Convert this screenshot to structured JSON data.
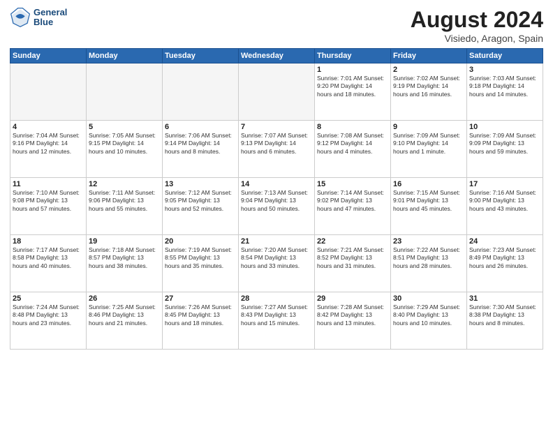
{
  "header": {
    "logo_line1": "General",
    "logo_line2": "Blue",
    "month_title": "August 2024",
    "location": "Visiedo, Aragon, Spain"
  },
  "weekdays": [
    "Sunday",
    "Monday",
    "Tuesday",
    "Wednesday",
    "Thursday",
    "Friday",
    "Saturday"
  ],
  "weeks": [
    [
      {
        "day": "",
        "info": ""
      },
      {
        "day": "",
        "info": ""
      },
      {
        "day": "",
        "info": ""
      },
      {
        "day": "",
        "info": ""
      },
      {
        "day": "1",
        "info": "Sunrise: 7:01 AM\nSunset: 9:20 PM\nDaylight: 14 hours\nand 18 minutes."
      },
      {
        "day": "2",
        "info": "Sunrise: 7:02 AM\nSunset: 9:19 PM\nDaylight: 14 hours\nand 16 minutes."
      },
      {
        "day": "3",
        "info": "Sunrise: 7:03 AM\nSunset: 9:18 PM\nDaylight: 14 hours\nand 14 minutes."
      }
    ],
    [
      {
        "day": "4",
        "info": "Sunrise: 7:04 AM\nSunset: 9:16 PM\nDaylight: 14 hours\nand 12 minutes."
      },
      {
        "day": "5",
        "info": "Sunrise: 7:05 AM\nSunset: 9:15 PM\nDaylight: 14 hours\nand 10 minutes."
      },
      {
        "day": "6",
        "info": "Sunrise: 7:06 AM\nSunset: 9:14 PM\nDaylight: 14 hours\nand 8 minutes."
      },
      {
        "day": "7",
        "info": "Sunrise: 7:07 AM\nSunset: 9:13 PM\nDaylight: 14 hours\nand 6 minutes."
      },
      {
        "day": "8",
        "info": "Sunrise: 7:08 AM\nSunset: 9:12 PM\nDaylight: 14 hours\nand 4 minutes."
      },
      {
        "day": "9",
        "info": "Sunrise: 7:09 AM\nSunset: 9:10 PM\nDaylight: 14 hours\nand 1 minute."
      },
      {
        "day": "10",
        "info": "Sunrise: 7:09 AM\nSunset: 9:09 PM\nDaylight: 13 hours\nand 59 minutes."
      }
    ],
    [
      {
        "day": "11",
        "info": "Sunrise: 7:10 AM\nSunset: 9:08 PM\nDaylight: 13 hours\nand 57 minutes."
      },
      {
        "day": "12",
        "info": "Sunrise: 7:11 AM\nSunset: 9:06 PM\nDaylight: 13 hours\nand 55 minutes."
      },
      {
        "day": "13",
        "info": "Sunrise: 7:12 AM\nSunset: 9:05 PM\nDaylight: 13 hours\nand 52 minutes."
      },
      {
        "day": "14",
        "info": "Sunrise: 7:13 AM\nSunset: 9:04 PM\nDaylight: 13 hours\nand 50 minutes."
      },
      {
        "day": "15",
        "info": "Sunrise: 7:14 AM\nSunset: 9:02 PM\nDaylight: 13 hours\nand 47 minutes."
      },
      {
        "day": "16",
        "info": "Sunrise: 7:15 AM\nSunset: 9:01 PM\nDaylight: 13 hours\nand 45 minutes."
      },
      {
        "day": "17",
        "info": "Sunrise: 7:16 AM\nSunset: 9:00 PM\nDaylight: 13 hours\nand 43 minutes."
      }
    ],
    [
      {
        "day": "18",
        "info": "Sunrise: 7:17 AM\nSunset: 8:58 PM\nDaylight: 13 hours\nand 40 minutes."
      },
      {
        "day": "19",
        "info": "Sunrise: 7:18 AM\nSunset: 8:57 PM\nDaylight: 13 hours\nand 38 minutes."
      },
      {
        "day": "20",
        "info": "Sunrise: 7:19 AM\nSunset: 8:55 PM\nDaylight: 13 hours\nand 35 minutes."
      },
      {
        "day": "21",
        "info": "Sunrise: 7:20 AM\nSunset: 8:54 PM\nDaylight: 13 hours\nand 33 minutes."
      },
      {
        "day": "22",
        "info": "Sunrise: 7:21 AM\nSunset: 8:52 PM\nDaylight: 13 hours\nand 31 minutes."
      },
      {
        "day": "23",
        "info": "Sunrise: 7:22 AM\nSunset: 8:51 PM\nDaylight: 13 hours\nand 28 minutes."
      },
      {
        "day": "24",
        "info": "Sunrise: 7:23 AM\nSunset: 8:49 PM\nDaylight: 13 hours\nand 26 minutes."
      }
    ],
    [
      {
        "day": "25",
        "info": "Sunrise: 7:24 AM\nSunset: 8:48 PM\nDaylight: 13 hours\nand 23 minutes."
      },
      {
        "day": "26",
        "info": "Sunrise: 7:25 AM\nSunset: 8:46 PM\nDaylight: 13 hours\nand 21 minutes."
      },
      {
        "day": "27",
        "info": "Sunrise: 7:26 AM\nSunset: 8:45 PM\nDaylight: 13 hours\nand 18 minutes."
      },
      {
        "day": "28",
        "info": "Sunrise: 7:27 AM\nSunset: 8:43 PM\nDaylight: 13 hours\nand 15 minutes."
      },
      {
        "day": "29",
        "info": "Sunrise: 7:28 AM\nSunset: 8:42 PM\nDaylight: 13 hours\nand 13 minutes."
      },
      {
        "day": "30",
        "info": "Sunrise: 7:29 AM\nSunset: 8:40 PM\nDaylight: 13 hours\nand 10 minutes."
      },
      {
        "day": "31",
        "info": "Sunrise: 7:30 AM\nSunset: 8:38 PM\nDaylight: 13 hours\nand 8 minutes."
      }
    ]
  ]
}
